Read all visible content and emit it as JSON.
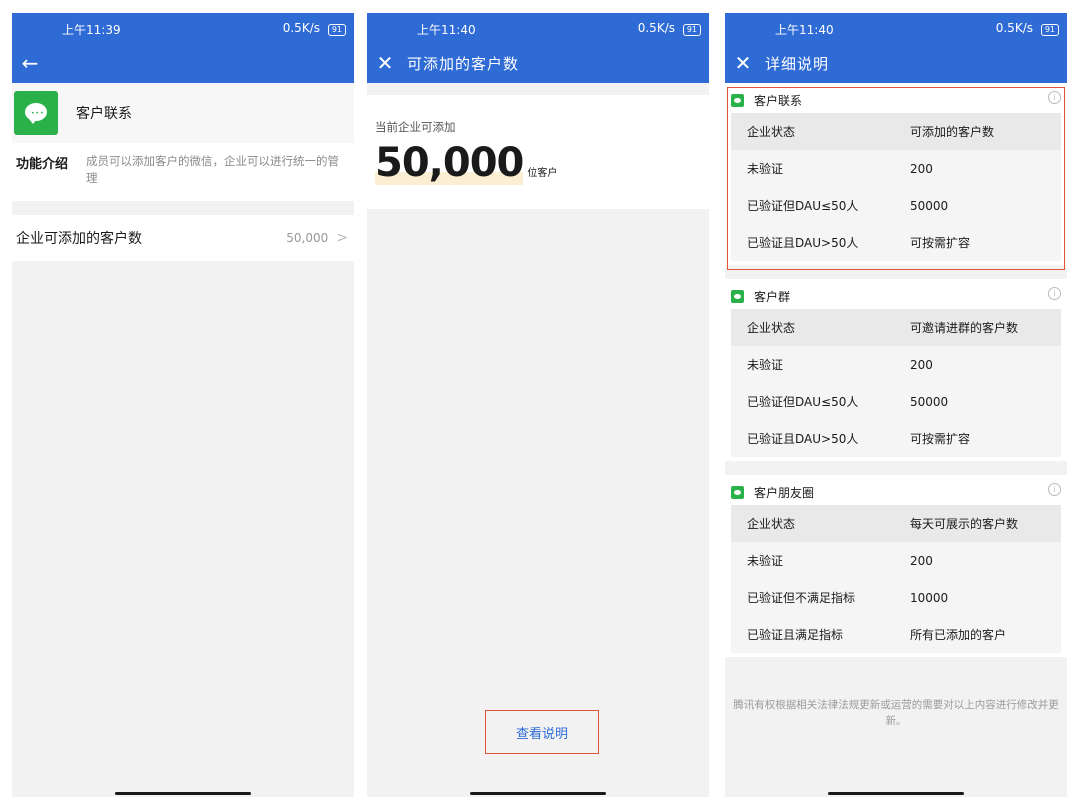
{
  "status": {
    "time1": "上午11:39",
    "time2": "上午11:40",
    "time3": "上午11:40",
    "speed": "0.5K/s",
    "battery": "91"
  },
  "screen1": {
    "back_icon": "arrow-left-icon",
    "app_name": "客户联系",
    "intro_key": "功能介绍",
    "intro_value": "成员可以添加客户的微信，企业可以进行统一的管理",
    "row_key": "企业可添加的客户数",
    "row_value": "50,000",
    "row_chevron": ">"
  },
  "screen2": {
    "close_icon": "close-icon",
    "title": "可添加的客户数",
    "label": "当前企业可添加",
    "count": "50,000",
    "unit": "位客户",
    "explain_button": "查看说明"
  },
  "screen3": {
    "close_icon": "close-icon",
    "title": "详细说明",
    "sections": [
      {
        "title": "客户联系",
        "header": [
          "企业状态",
          "可添加的客户数"
        ],
        "rows": [
          [
            "未验证",
            "200"
          ],
          [
            "已验证但DAU≤50人",
            "50000"
          ],
          [
            "已验证且DAU>50人",
            "可按需扩容"
          ]
        ]
      },
      {
        "title": "客户群",
        "header": [
          "企业状态",
          "可邀请进群的客户数"
        ],
        "rows": [
          [
            "未验证",
            "200"
          ],
          [
            "已验证但DAU≤50人",
            "50000"
          ],
          [
            "已验证且DAU>50人",
            "可按需扩容"
          ]
        ]
      },
      {
        "title": "客户朋友圈",
        "header": [
          "企业状态",
          "每天可展示的客户数"
        ],
        "rows": [
          [
            "未验证",
            "200"
          ],
          [
            "已验证但不满足指标",
            "10000"
          ],
          [
            "已验证且满足指标",
            "所有已添加的客户"
          ]
        ]
      }
    ],
    "footer": "腾讯有权根据相关法律法规更新或运营的需要对以上内容进行修改并更新。"
  },
  "colors": {
    "brand_blue": "#2f6bd5",
    "accent_red": "#e2533a",
    "green": "#2bb14a"
  }
}
